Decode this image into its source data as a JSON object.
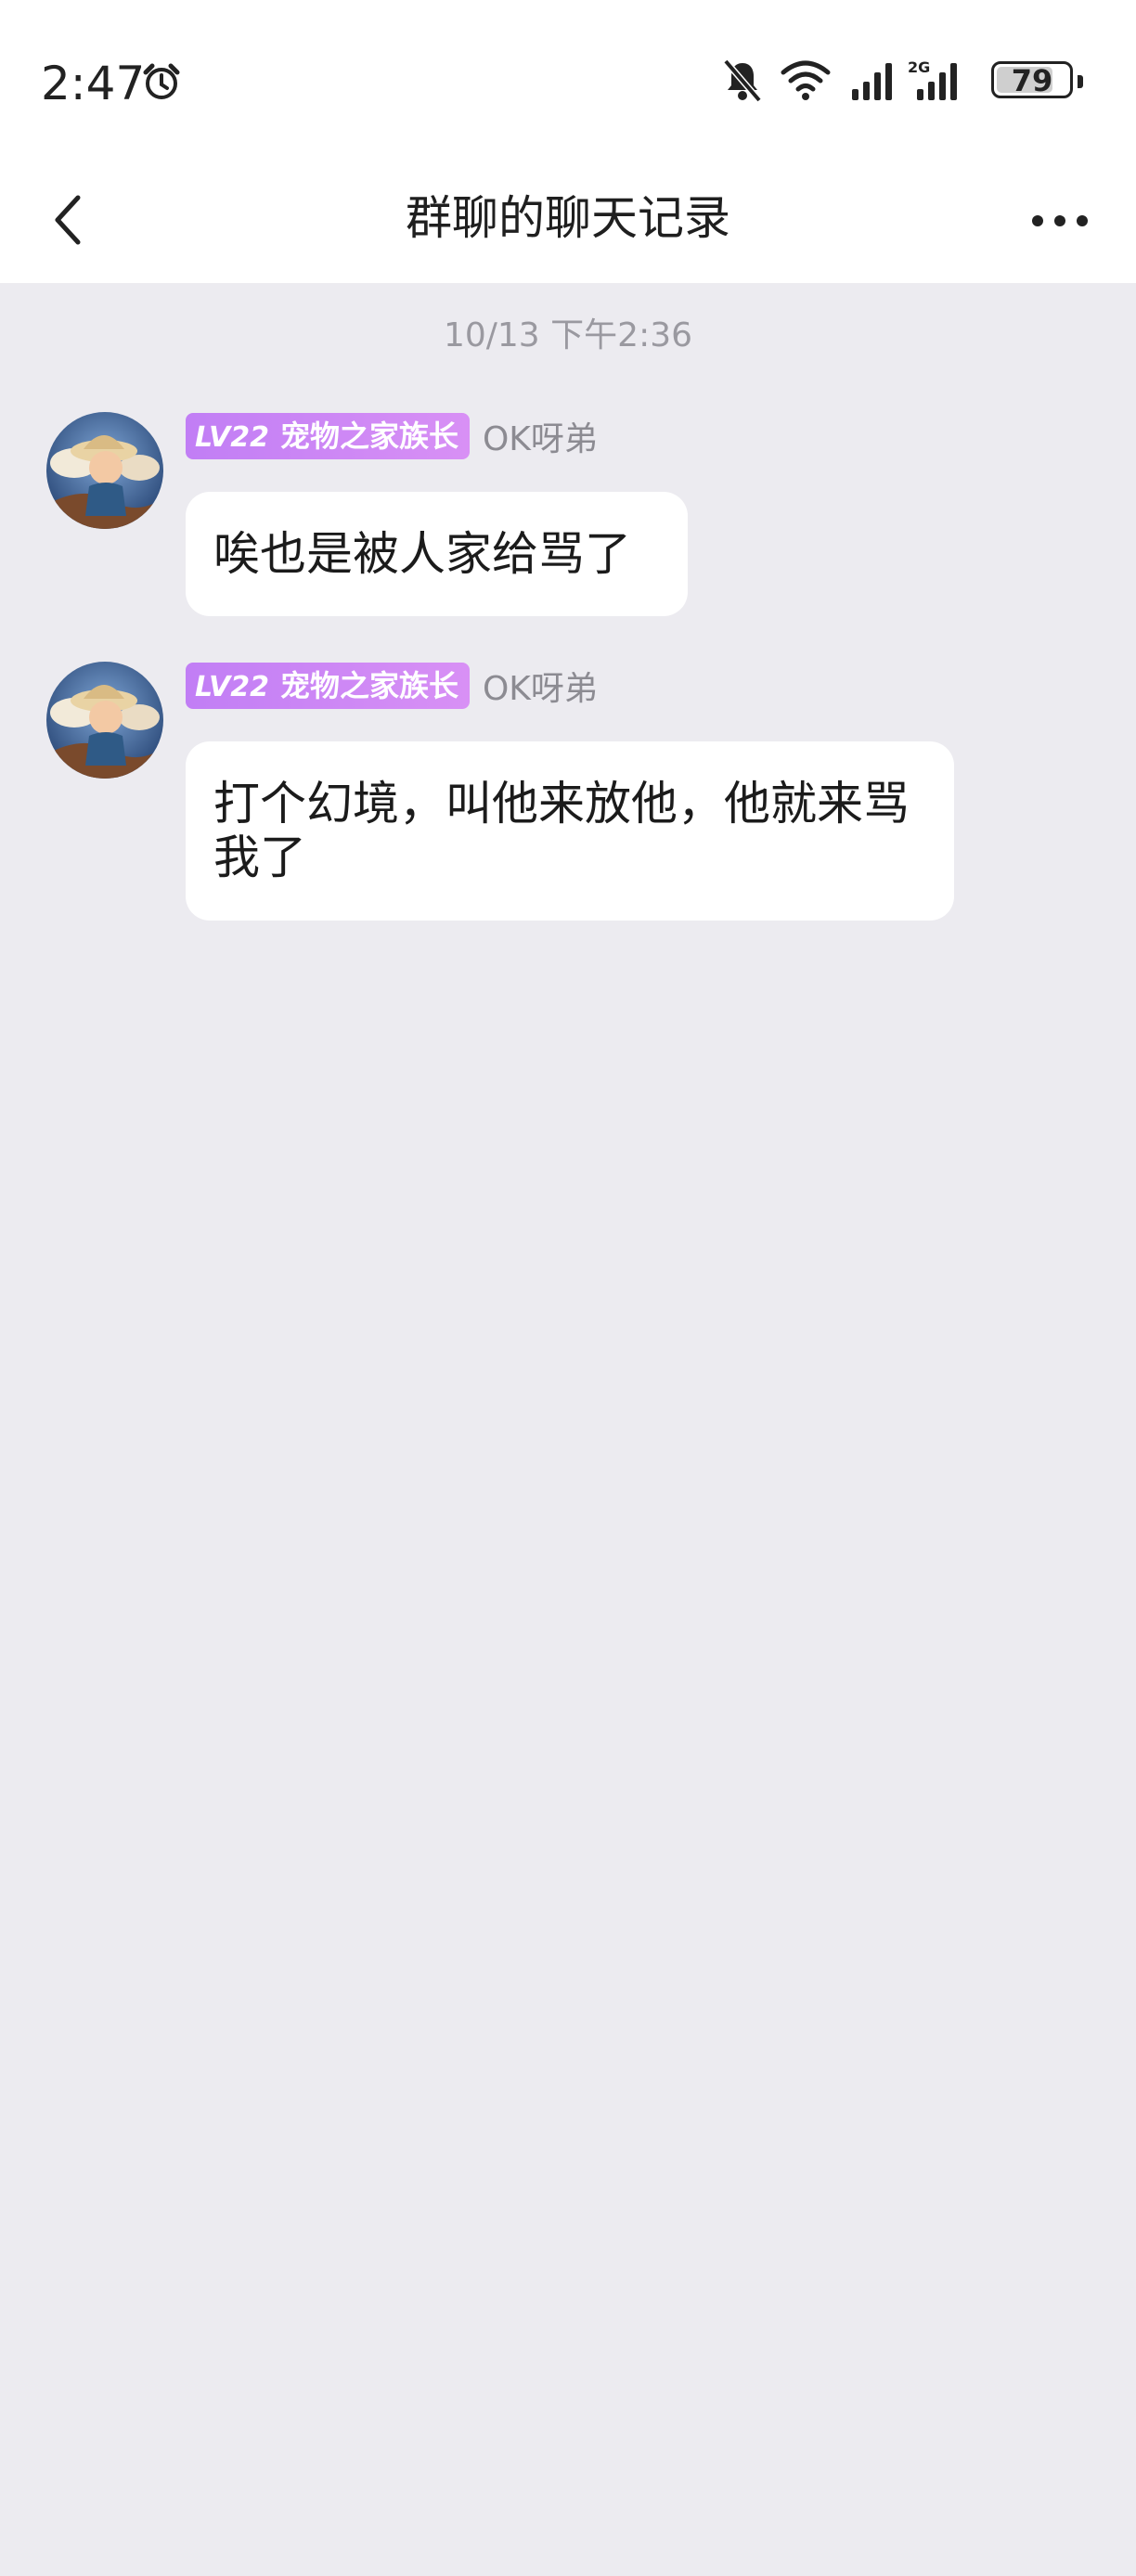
{
  "status_bar": {
    "time": "2:47",
    "battery": "79",
    "network": "2G",
    "icons": [
      "alarm-icon",
      "bell-off-icon",
      "wifi-icon",
      "signal-icon",
      "signal-2g-icon",
      "battery-icon"
    ]
  },
  "nav": {
    "title": "群聊的聊天记录",
    "back_icon": "chevron-left-icon",
    "more_icon": "more-dots-icon"
  },
  "chat": {
    "timestamp": "10/13 下午2:36",
    "messages": [
      {
        "level": "LV22",
        "badge_text": "宠物之家族长",
        "sender": "OK呀弟",
        "text": "唉也是被人家给骂了"
      },
      {
        "level": "LV22",
        "badge_text": "宠物之家族长",
        "sender": "OK呀弟",
        "text": "打个幻境，叫他来放他，他就来骂我了"
      }
    ]
  },
  "colors": {
    "background": "#ecebf0",
    "badge": "#c88af5",
    "bubble": "#ffffff"
  }
}
